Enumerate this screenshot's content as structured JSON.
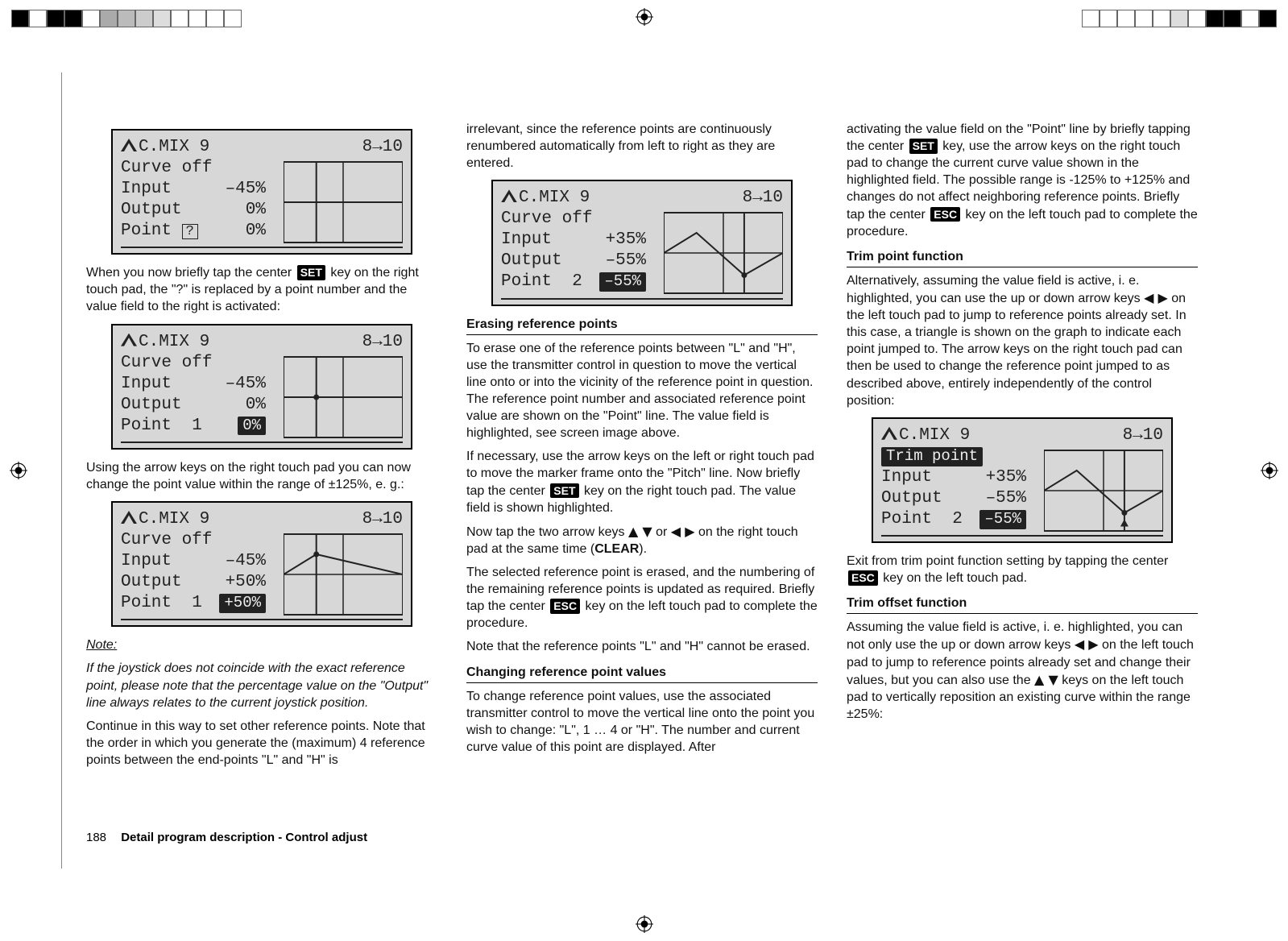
{
  "lcd_common": {
    "title": "C.MIX  9",
    "channel": "8→10",
    "curve_row": "Curve   off",
    "point_q": "?"
  },
  "lcd1": {
    "input_lbl": "Input",
    "input_val": "–45%",
    "output_lbl": "Output",
    "output_val": "0%",
    "point_lbl": "Point",
    "point_num": "?",
    "point_val": "0%"
  },
  "lcd2": {
    "input_lbl": "Input",
    "input_val": "–45%",
    "output_lbl": "Output",
    "output_val": "0%",
    "point_lbl": "Point",
    "point_num": "1",
    "point_val": "0%"
  },
  "lcd3": {
    "input_lbl": "Input",
    "input_val": "–45%",
    "output_lbl": "Output",
    "output_val": "+50%",
    "point_lbl": "Point",
    "point_num": "1",
    "point_val": "+50%"
  },
  "lcd4": {
    "input_lbl": "Input",
    "input_val": "+35%",
    "output_lbl": "Output",
    "output_val": "–55%",
    "point_lbl": "Point",
    "point_num": "2",
    "point_val": "–55%"
  },
  "lcd5": {
    "trim_label": "Trim point",
    "input_lbl": "Input",
    "input_val": "+35%",
    "output_lbl": "Output",
    "output_val": "–55%",
    "point_lbl": "Point",
    "point_num": "2",
    "point_val": "–55%"
  },
  "col1": {
    "p1a": "When you now briefly tap the center ",
    "set": "SET",
    "p1b": " key on the right touch pad, the \"?\" is replaced by a point number and the value field to the right is activated:",
    "p2": "Using the arrow keys on the right touch pad you can now change the point value within the range of ±125%, e. g.:",
    "note_h": "Note:",
    "note": "If the joystick does not coincide with the exact reference point, please note that the percentage value on the \"Output\" line always relates to the current joystick position.",
    "p3": "Continue in this way to set other reference points. Note that the order in which you generate the (maximum) 4 reference points between the end-points \"L\" and \"H\" is"
  },
  "col2": {
    "p1": "irrelevant, since the reference points are continuously renumbered automatically from left to right as they are entered.",
    "h1": "Erasing reference points",
    "p2": "To erase one of the reference points between \"L\" and \"H\", use the transmitter control in question to move the vertical line onto or into the vicinity of the reference point in question. The reference point number and associated reference point value are shown on the \"Point\" line. The value field is highlighted, see screen image above.",
    "p3a": "If necessary, use the arrow keys on the left or right touch pad to move the marker frame onto the \"Pitch\" line. Now briefly tap the center ",
    "p3b": " key on the right touch pad. The value field is shown highlighted.",
    "p4a": "Now tap the two arrow keys ",
    "p4_arr1": "▲ ▼",
    "p4_or": " or ",
    "p4_arr2": "◀ ▶",
    "p4b": " on the right touch pad at the same time (",
    "clear": "CLEAR",
    "p4c": ").",
    "p5a": "The selected reference point is erased, and the numbering of the remaining reference points is updated as required. Briefly tap the center ",
    "esc": "ESC",
    "p5b": " key on the left touch pad to complete the procedure.",
    "p6": "Note that the reference points \"L\" and \"H\" cannot be erased.",
    "h2": "Changing reference point values",
    "p7": "To change reference point values, use the associated transmitter control to move the vertical line onto the point you wish to change: \"L\", 1 … 4 or \"H\". The number and current curve value of this point are displayed. After"
  },
  "col3": {
    "p1a": "activating the value field on the \"Point\" line by briefly tapping the center ",
    "p1b": " key, use the arrow keys on the right touch pad to change the current curve value shown in the highlighted field. The possible range is -125% to +125% and changes do not affect neighboring reference points. Briefly tap the center ",
    "p1c": " key on the left touch pad to complete the procedure.",
    "h1": "Trim point function",
    "p2a": "Alternatively, assuming the value field is active, i. e. highlighted, you can use the up or down arrow keys ",
    "p2_arr": "◀ ▶",
    "p2b": " on the left touch pad to jump to reference points already set. In this case, a triangle is shown on the graph to indicate each point jumped to. The arrow keys on the right touch pad can then be used to change the reference point jumped to as described above, entirely independently of the control position:",
    "p3a": "Exit from trim point function setting by tapping the center ",
    "p3b": " key on the left touch pad.",
    "h2": "Trim offset function",
    "p4a": "Assuming the value field is active, i. e. highlighted, you can not only use the up or down arrow keys ",
    "p4_arr1": "◀ ▶",
    "p4b": " on the left touch pad to jump to reference points already set and change their values, but you can also use the ",
    "p4_arr2": "▲ ▼",
    "p4c": " keys on the left touch pad to vertically reposition an existing curve within the range ±25%:"
  },
  "footer": {
    "page": "188",
    "title": "Detail program description - Control adjust"
  },
  "chart_data": [
    {
      "id": "lcd1-graph",
      "type": "line",
      "xlim": [
        -100,
        100
      ],
      "ylim": [
        -100,
        100
      ],
      "series": [
        {
          "name": "curve",
          "x": [
            -100,
            100
          ],
          "y": [
            0,
            0
          ]
        }
      ],
      "cursor_x": -45
    },
    {
      "id": "lcd2-graph",
      "type": "line",
      "xlim": [
        -100,
        100
      ],
      "ylim": [
        -100,
        100
      ],
      "series": [
        {
          "name": "curve",
          "x": [
            -100,
            100
          ],
          "y": [
            0,
            0
          ]
        }
      ],
      "cursor_x": -45,
      "marker": {
        "x": -45,
        "y": 0
      }
    },
    {
      "id": "lcd3-graph",
      "type": "line",
      "xlim": [
        -100,
        100
      ],
      "ylim": [
        -100,
        100
      ],
      "series": [
        {
          "name": "curve",
          "x": [
            -100,
            -45,
            100
          ],
          "y": [
            0,
            50,
            0
          ]
        }
      ],
      "cursor_x": -45,
      "marker": {
        "x": -45,
        "y": 50
      }
    },
    {
      "id": "lcd4-graph",
      "type": "line",
      "xlim": [
        -100,
        100
      ],
      "ylim": [
        -100,
        100
      ],
      "series": [
        {
          "name": "curve",
          "x": [
            -100,
            -45,
            35,
            100
          ],
          "y": [
            0,
            50,
            -55,
            0
          ]
        }
      ],
      "cursor_x": 35,
      "marker": {
        "x": 35,
        "y": -55
      }
    },
    {
      "id": "lcd5-graph",
      "type": "line",
      "xlim": [
        -100,
        100
      ],
      "ylim": [
        -100,
        100
      ],
      "series": [
        {
          "name": "curve",
          "x": [
            -100,
            -45,
            35,
            100
          ],
          "y": [
            0,
            50,
            -55,
            0
          ]
        }
      ],
      "cursor_x": 35,
      "marker": {
        "x": 35,
        "y": -55
      },
      "triangle": {
        "x": 35,
        "y": -55
      }
    }
  ]
}
